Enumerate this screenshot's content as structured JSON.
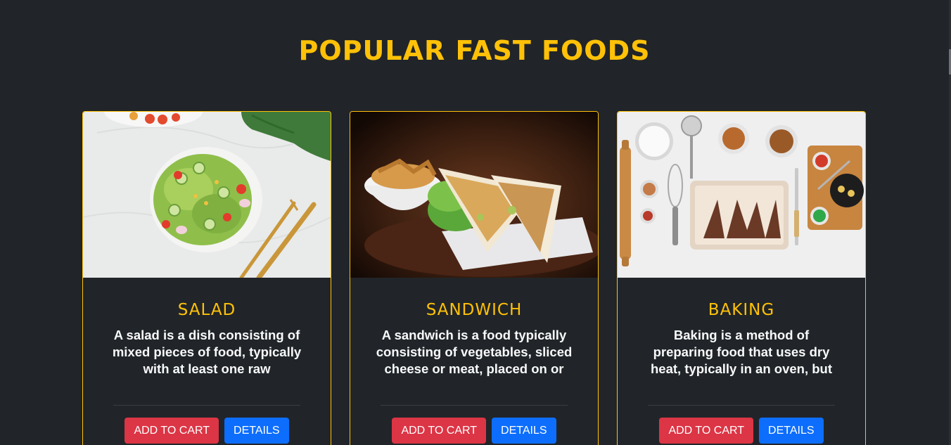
{
  "page": {
    "heading": "POPULAR FAST FOODS"
  },
  "colors": {
    "background": "#212529",
    "accent": "#ffc107",
    "add_to_cart": "#dc3545",
    "details": "#0d6efd"
  },
  "cards": [
    {
      "image": "salad-photo",
      "title": "SALAD",
      "description": "A salad is a dish consisting of mixed pieces of food, typically with at least one raw ingredient.",
      "add_to_cart_label": "ADD TO CART",
      "details_label": "DETAILS"
    },
    {
      "image": "sandwich-photo",
      "title": "SANDWICH",
      "description": "A sandwich is a food typically consisting of vegetables, sliced cheese or meat, placed on or",
      "add_to_cart_label": "ADD TO CART",
      "details_label": "DETAILS"
    },
    {
      "image": "baking-photo",
      "title": "BAKING",
      "description": "Baking is a method of preparing food that uses dry heat, typically in an oven, but can also be done",
      "add_to_cart_label": "ADD TO CART",
      "details_label": "DETAILS"
    }
  ]
}
